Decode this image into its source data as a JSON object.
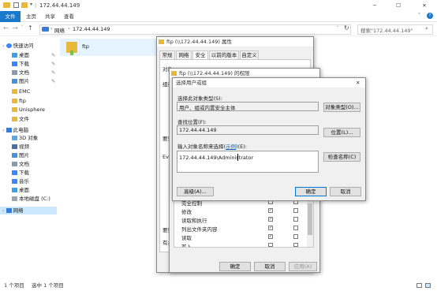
{
  "explorer": {
    "title": "172.44.44.149",
    "ribbon": {
      "file": "文件",
      "home": "主页",
      "share": "共享",
      "view": "查看"
    },
    "address": {
      "segments": [
        "网络",
        "172.44.44.149"
      ]
    },
    "search": {
      "placeholder": "搜索\"172.44.44.149\""
    },
    "nav": {
      "quick_access": "快速访问",
      "items": [
        "桌面",
        "下载",
        "文档",
        "图片",
        "EMC",
        "ftp",
        "Unisphere VNX Cl",
        "文件"
      ],
      "this_pc": "此电脑",
      "pc_items": [
        "3D 对象",
        "视频",
        "图片",
        "文档",
        "下载",
        "音乐",
        "桌面",
        "本地磁盘 (C:)"
      ],
      "network": "网络"
    },
    "content": {
      "folder_name": "ftp"
    },
    "status": {
      "count": "1 个项目",
      "selected": "选中 1 个项目"
    }
  },
  "props_dialog": {
    "title": "ftp (\\\\172.44.44.149) 属性",
    "tabs": [
      "常规",
      "网络",
      "安全",
      "以前的版本",
      "自定义"
    ],
    "labels": [
      "对象",
      "组或",
      "要更",
      "Ev",
      "要更",
      "有关"
    ],
    "buttons": {
      "ok": "确定",
      "cancel": "取消",
      "apply": "应用(A)"
    }
  },
  "perm_dialog": {
    "title": "ftp (\\\\172.44.44.149) 的权限",
    "perm_rows": [
      "完全控制",
      "修改",
      "读取和执行",
      "列出文件夹内容",
      "读取",
      "写入"
    ],
    "allow_checked": [
      false,
      true,
      true,
      true,
      true,
      false
    ],
    "buttons": {
      "ok": "确定",
      "cancel": "取消",
      "apply": "应用(A)"
    }
  },
  "select_dialog": {
    "title": "选择用户或组",
    "object_type_label": "选择此对象类型(S):",
    "object_type_value": "用户、组或内置安全主体",
    "object_type_btn": "对象类型(O)...",
    "location_label": "查找位置(F):",
    "location_value": "172.44.44.149",
    "location_btn": "位置(L)...",
    "enter_label": "输入对象名称来选择(",
    "enter_link": "示例",
    "enter_label_end": ")(E):",
    "enter_value": "172.44.44.149\\Administrator",
    "check_btn": "检查名称(C)",
    "advanced_btn": "高级(A)...",
    "ok": "确定",
    "cancel": "取消"
  }
}
